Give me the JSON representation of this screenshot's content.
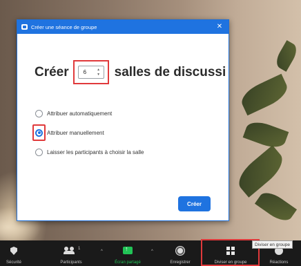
{
  "dialog": {
    "title": "Créer une séance de groupe",
    "close_glyph": "✕",
    "heading_prefix": "Créer",
    "room_count": "6",
    "heading_suffix": "salles de discussi",
    "options": [
      {
        "label": "Attribuer automatiquement",
        "checked": false
      },
      {
        "label": "Attribuer manuellement",
        "checked": true
      },
      {
        "label": "Laisser les participants à choisir la salle",
        "checked": false
      }
    ],
    "create_button": "Créer"
  },
  "toolbar": {
    "security": "Sécurité",
    "participants": "Participants",
    "participants_count": "1",
    "share_screen": "Écran partagé",
    "record": "Enregistrer",
    "breakout": "Diviser en groupe",
    "reactions": "Réactions",
    "caret": "^"
  },
  "tooltip": "Diviser en groupe",
  "colors": {
    "accent": "#1f73e0",
    "highlight": "#e0393b",
    "share_green": "#21c356"
  }
}
